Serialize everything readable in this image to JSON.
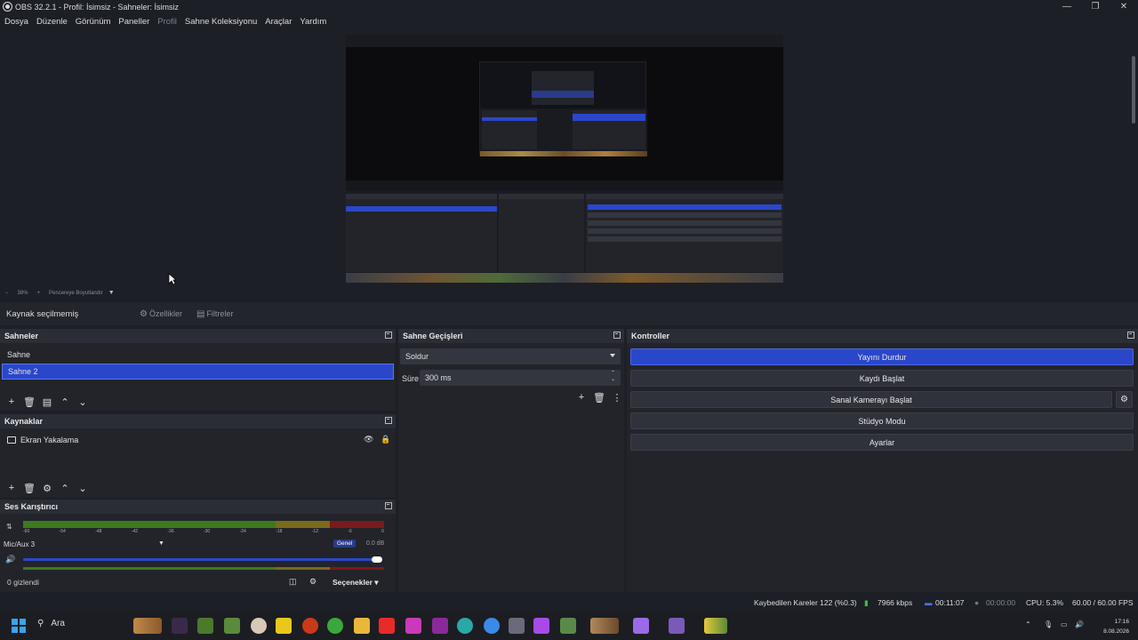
{
  "window": {
    "title": "OBS 32.2.1 - Profil: İsimsiz - Sahneler: İsimsiz",
    "controls": [
      "—",
      "❐",
      "✕"
    ]
  },
  "menu": {
    "items": [
      {
        "label": "Dosya",
        "disabled": false
      },
      {
        "label": "Düzenle",
        "disabled": false
      },
      {
        "label": "Görünüm",
        "disabled": false
      },
      {
        "label": "Paneller",
        "disabled": false
      },
      {
        "label": "Profil",
        "disabled": true
      },
      {
        "label": "Sahne Koleksiyonu",
        "disabled": false
      },
      {
        "label": "Araçlar",
        "disabled": false
      },
      {
        "label": "Yardım",
        "disabled": false
      }
    ]
  },
  "zoombar": {
    "minus": "−",
    "zoom": "38%",
    "plus": "+",
    "mode": "Pencereye Boyutlandır"
  },
  "context": {
    "label": "Kaynak seçilmemiş",
    "properties": "Özellikler",
    "filters": "Filtreler"
  },
  "scenes": {
    "title": "Sahneler",
    "items": [
      {
        "label": "Sahne",
        "selected": false
      },
      {
        "label": "Sahne 2",
        "selected": true
      }
    ]
  },
  "sources": {
    "title": "Kaynaklar",
    "items": [
      {
        "label": "Ekran Yakalama",
        "icon": "monitor-icon"
      }
    ]
  },
  "mixer": {
    "title": "Ses Karıştırıcı",
    "ticks": [
      "-60",
      "-54",
      "-48",
      "-42",
      "-36",
      "-30",
      "-24",
      "-18",
      "-12",
      "-6",
      "0"
    ],
    "channel_name": "Mic/Aux 3",
    "channel_badge": "Genel",
    "channel_db": "0.0 dB",
    "volume": 1.0,
    "hidden": "0 gizlendi",
    "options": "Seçenekler"
  },
  "transitions": {
    "title": "Sahne Geçişleri",
    "selected": "Soldur",
    "duration_label": "Süre",
    "duration_value": "300 ms"
  },
  "controls": {
    "title": "Kontroller",
    "stop_stream": "Yayını Durdur",
    "start_record": "Kaydı Başlat",
    "start_virtualcam": "Sanal Kamerayı Başlat",
    "studio_mode": "Stüdyo Modu",
    "settings": "Ayarlar"
  },
  "status": {
    "dropped": "Kaybedilen Kareler 122 (%0.3)",
    "bitrate": "7966 kbps",
    "stream_time": "00:11:07",
    "record_time": "00:00:00",
    "cpu": "CPU: 5.3%",
    "fps": "60.00 / 60.00 FPS"
  },
  "taskbar": {
    "search": "Ara",
    "time": "17:16",
    "date": "8.08.2026"
  },
  "colors": {
    "accent": "#2b47c9",
    "meter_green": "#3c7a1e",
    "meter_yellow": "#7a6a1a",
    "meter_red": "#7a1a1a"
  }
}
